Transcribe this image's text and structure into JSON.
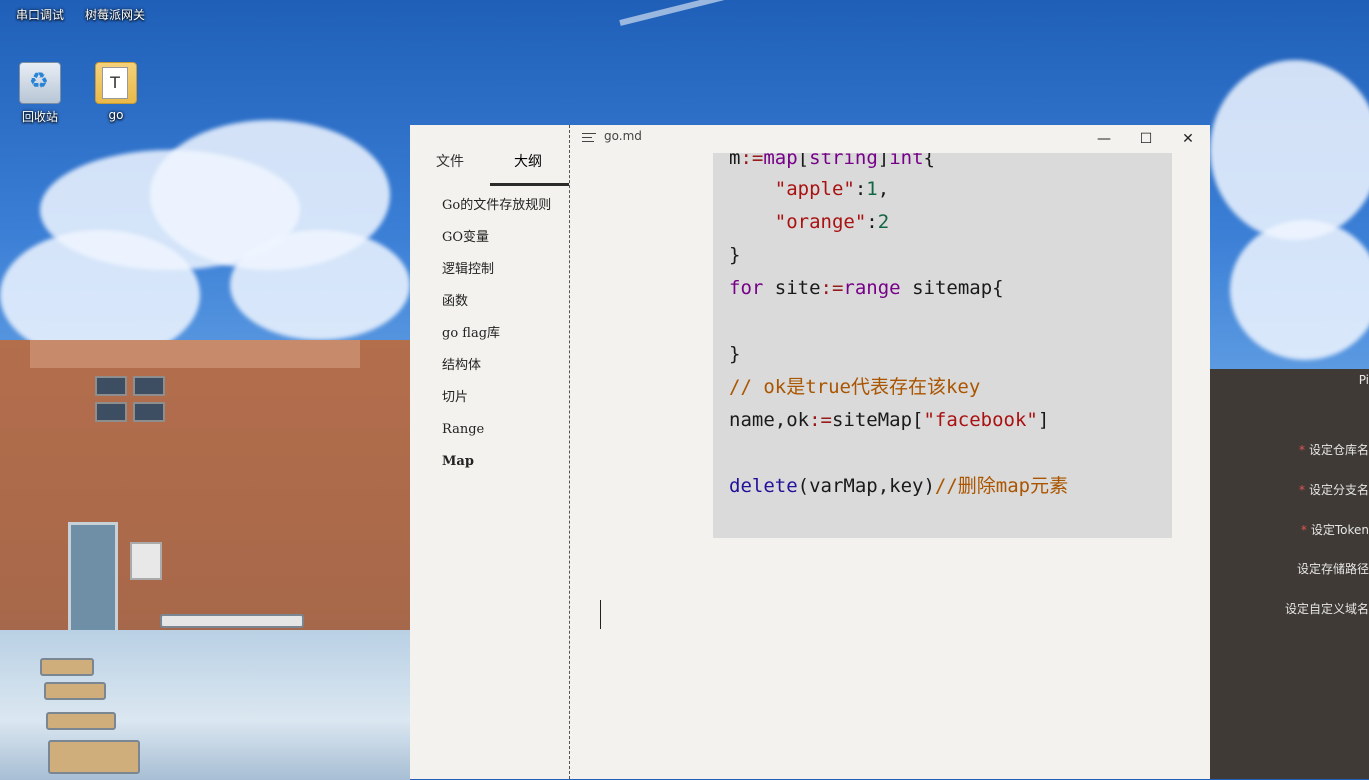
{
  "desktop": {
    "icons": [
      {
        "label": "串口调试"
      },
      {
        "label": "树莓派网关"
      },
      {
        "label": "回收站"
      },
      {
        "label": "go"
      }
    ],
    "go_icon_glyph": "T"
  },
  "window": {
    "title": "go.md",
    "minimize": "—",
    "maximize": "☐",
    "close": "✕"
  },
  "sidebar": {
    "tabs": {
      "files": "文件",
      "outline": "大纲"
    },
    "outline": [
      "Go的文件存放规则",
      "GO变量",
      "逻辑控制",
      "函数",
      "go flag库",
      "结构体",
      "切片",
      "Range",
      "Map"
    ]
  },
  "code": {
    "l1": {
      "a": "m",
      "b": ":=",
      "c": "map",
      "d": "[",
      "e": "string",
      "f": "]",
      "g": "int",
      "h": "{"
    },
    "l2": {
      "a": "    ",
      "b": "\"apple\"",
      "c": ":",
      "d": "1",
      "e": ","
    },
    "l3": {
      "a": "    ",
      "b": "\"orange\"",
      "c": ":",
      "d": "2"
    },
    "l4": "}",
    "l5": {
      "a": "for",
      "b": " site",
      "c": ":=",
      "d": "range",
      "e": " sitemap{"
    },
    "l6": "}",
    "l7": "// ok是true代表存在该key",
    "l8": {
      "a": "name,ok",
      "b": ":=",
      "c": "siteMap[",
      "d": "\"facebook\"",
      "e": "]"
    },
    "l9": {
      "a": "delete",
      "b": "(varMap,key)",
      "c": "//删除map元素"
    }
  },
  "bg_panel": {
    "top_label": "Pi",
    "required_mark": "*",
    "rows": [
      {
        "label": "设定仓库名",
        "required": true
      },
      {
        "label": "设定分支名",
        "required": true
      },
      {
        "label": "设定Token",
        "required": true
      },
      {
        "label": "设定存储路径",
        "required": false
      },
      {
        "label": "设定自定义域名",
        "required": false
      }
    ]
  },
  "colors": {
    "editor_bg": "#f3f2ee",
    "code_bg": "#dadada",
    "keyword": "#770088",
    "string": "#aa1111",
    "number": "#116644",
    "comment": "#aa5500"
  }
}
